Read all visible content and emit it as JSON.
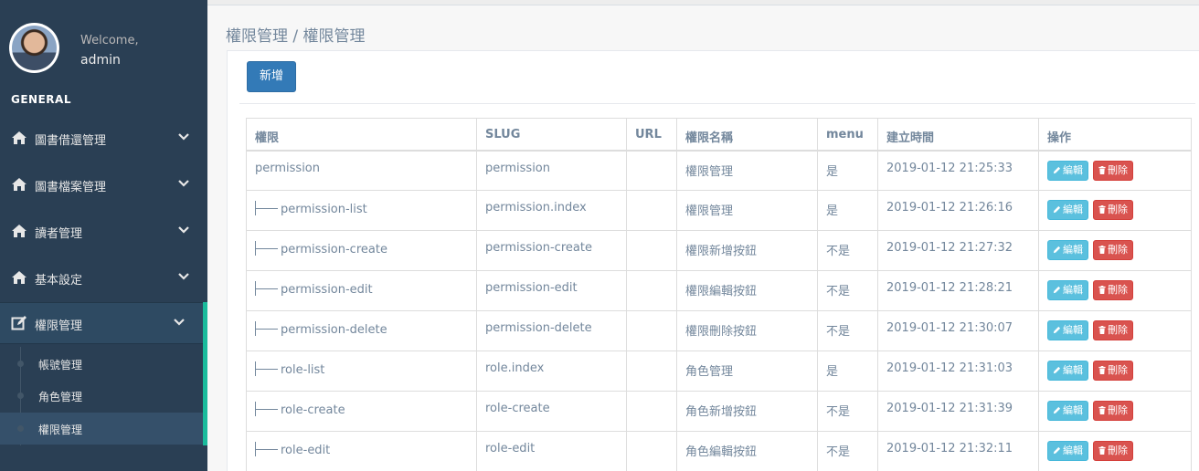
{
  "profile": {
    "welcome": "Welcome,",
    "username": "admin"
  },
  "sidebar": {
    "section_title": "GENERAL",
    "items": [
      {
        "label": "圖書借還管理",
        "icon": "home-icon"
      },
      {
        "label": "圖書檔案管理",
        "icon": "home-icon"
      },
      {
        "label": "讀者管理",
        "icon": "home-icon"
      },
      {
        "label": "基本設定",
        "icon": "home-icon"
      },
      {
        "label": "權限管理",
        "icon": "edit-icon"
      }
    ],
    "submenu": [
      {
        "label": "帳號管理"
      },
      {
        "label": "角色管理"
      },
      {
        "label": "權限管理"
      }
    ]
  },
  "breadcrumb": "權限管理 / 權限管理",
  "toolbar": {
    "add_label": "新增"
  },
  "table": {
    "headers": [
      "權限",
      "SLUG",
      "URL",
      "權限名稱",
      "menu",
      "建立時間",
      "操作"
    ],
    "edit_label": "編輯",
    "delete_label": "刪除",
    "rows": [
      {
        "level": 0,
        "name": "permission",
        "slug": "permission",
        "url": "",
        "title": "權限管理",
        "menu": "是",
        "created": "2019-01-12 21:25:33"
      },
      {
        "level": 1,
        "name": "permission-list",
        "slug": "permission.index",
        "url": "",
        "title": "權限管理",
        "menu": "是",
        "created": "2019-01-12 21:26:16"
      },
      {
        "level": 2,
        "name": "permission-create",
        "slug": "permission-create",
        "url": "",
        "title": "權限新增按鈕",
        "menu": "不是",
        "created": "2019-01-12 21:27:32"
      },
      {
        "level": 2,
        "name": "permission-edit",
        "slug": "permission-edit",
        "url": "",
        "title": "權限編輯按鈕",
        "menu": "不是",
        "created": "2019-01-12 21:28:21"
      },
      {
        "level": 2,
        "name": "permission-delete",
        "slug": "permission-delete",
        "url": "",
        "title": "權限刪除按鈕",
        "menu": "不是",
        "created": "2019-01-12 21:30:07"
      },
      {
        "level": 1,
        "name": "role-list",
        "slug": "role.index",
        "url": "",
        "title": "角色管理",
        "menu": "是",
        "created": "2019-01-12 21:31:03"
      },
      {
        "level": 2,
        "name": "role-create",
        "slug": "role-create",
        "url": "",
        "title": "角色新增按鈕",
        "menu": "不是",
        "created": "2019-01-12 21:31:39"
      },
      {
        "level": 2,
        "name": "role-edit",
        "slug": "role-edit",
        "url": "",
        "title": "角色編輯按鈕",
        "menu": "不是",
        "created": "2019-01-12 21:32:11"
      }
    ]
  },
  "colors": {
    "sidebar_bg": "#2a3f54",
    "accent": "#1abb9c",
    "primary": "#337ab7",
    "info": "#5bc0de",
    "danger": "#d9534f"
  }
}
